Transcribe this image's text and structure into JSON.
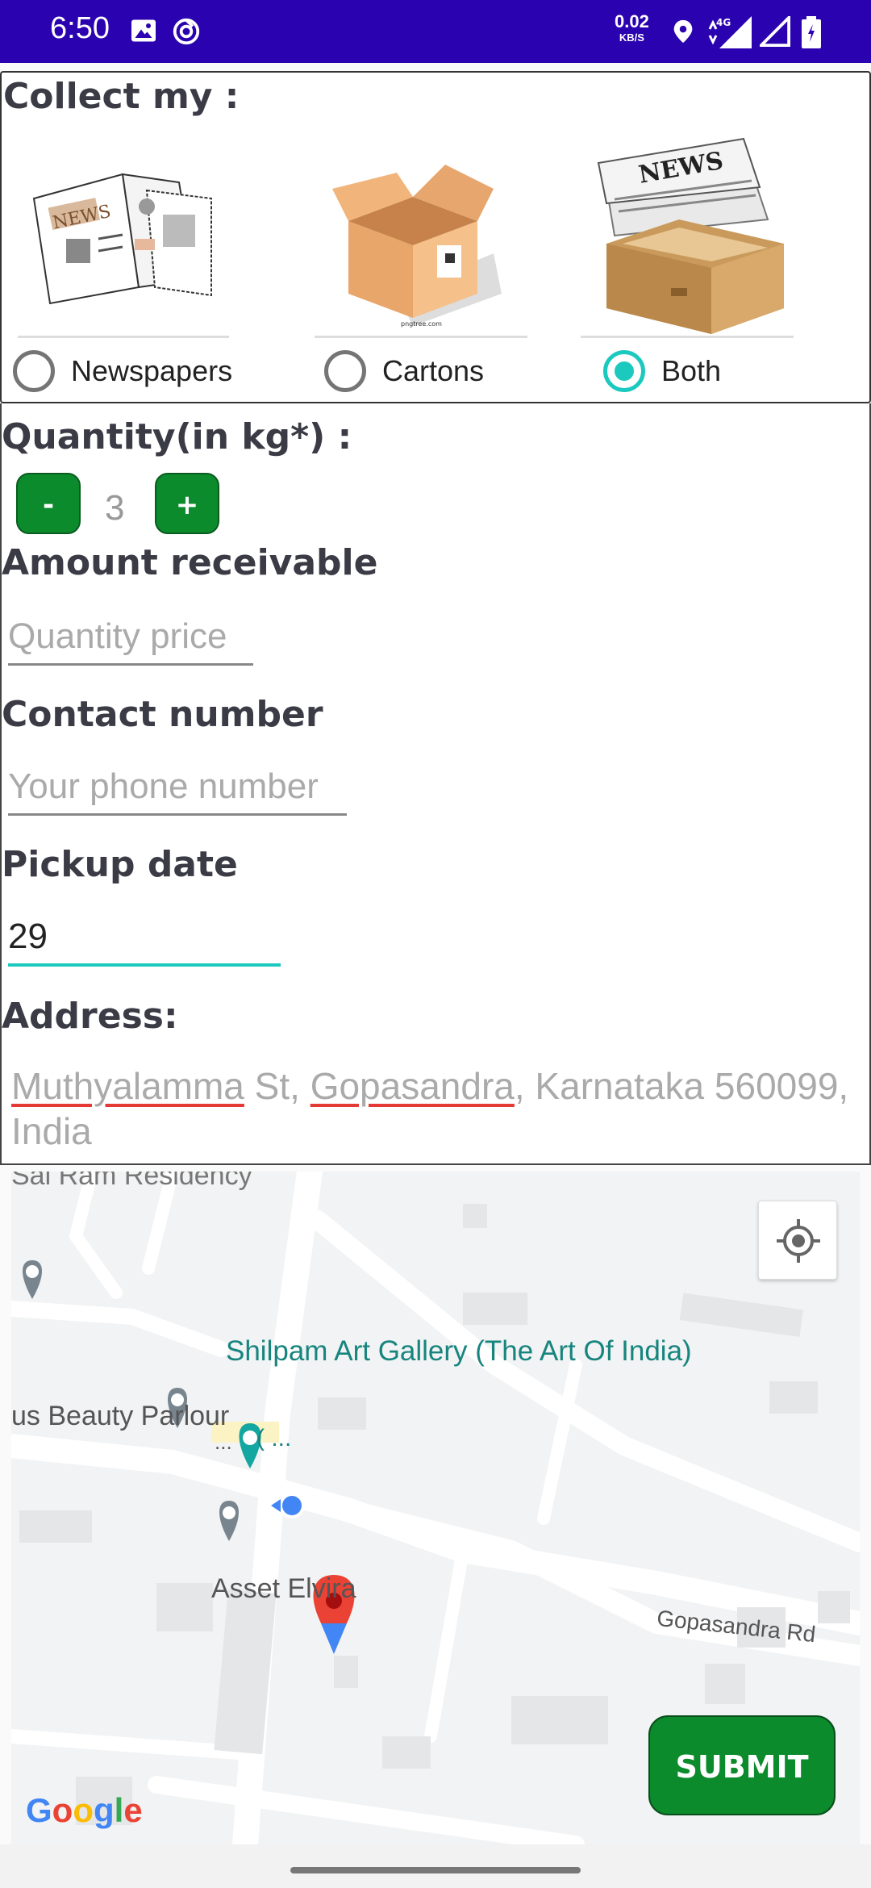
{
  "status_bar": {
    "time": "6:50",
    "speed_value": "0.02",
    "speed_unit": "KB/S",
    "network": "4G",
    "icons": [
      "image-icon",
      "data-saver-icon",
      "location-icon",
      "signal-icon",
      "battery-icon"
    ]
  },
  "collect": {
    "heading": "Collect my :",
    "options": [
      {
        "label": "Newspapers",
        "checked": false
      },
      {
        "label": "Cartons",
        "checked": false
      },
      {
        "label": "Both",
        "checked": true
      }
    ],
    "images": {
      "newspaper_text": "NEWS",
      "carton_caption": "pngtree.com",
      "both_text": "NEWS"
    }
  },
  "quantity": {
    "heading": "Quantity(in kg*) :",
    "minus_label": "-",
    "plus_label": "+",
    "value": "3"
  },
  "amount": {
    "heading": "Amount receivable",
    "placeholder": "Quantity price"
  },
  "contact": {
    "heading": "Contact number",
    "placeholder": "Your phone number"
  },
  "pickup": {
    "heading": "Pickup date",
    "value": "29"
  },
  "address": {
    "heading": "Address:",
    "part1": "Muthyalamma",
    "part2": " St, ",
    "part3": "Gopasandra",
    "part4": ", Karnataka 560099, India"
  },
  "map": {
    "labels": {
      "residency": "Sai Ram Residency",
      "gallery": "Shilpam Art Gallery (The Art Of India)",
      "parlour": "us Beauty Parlour",
      "asset": "Asset Elvira",
      "road": "Gopasandra Rd",
      "paren": "( ...",
      "dots": "..."
    },
    "google_letters": [
      "G",
      "o",
      "o",
      "g",
      "l",
      "e"
    ],
    "google_colors": [
      "#4285F4",
      "#EA4335",
      "#FBBC05",
      "#4285F4",
      "#34A853",
      "#EA4335"
    ]
  },
  "submit_label": "SUBMIT",
  "colors": {
    "status_bar": "#2a02b0",
    "accent": "#1cc9be",
    "button_green": "#0b8b2c"
  }
}
